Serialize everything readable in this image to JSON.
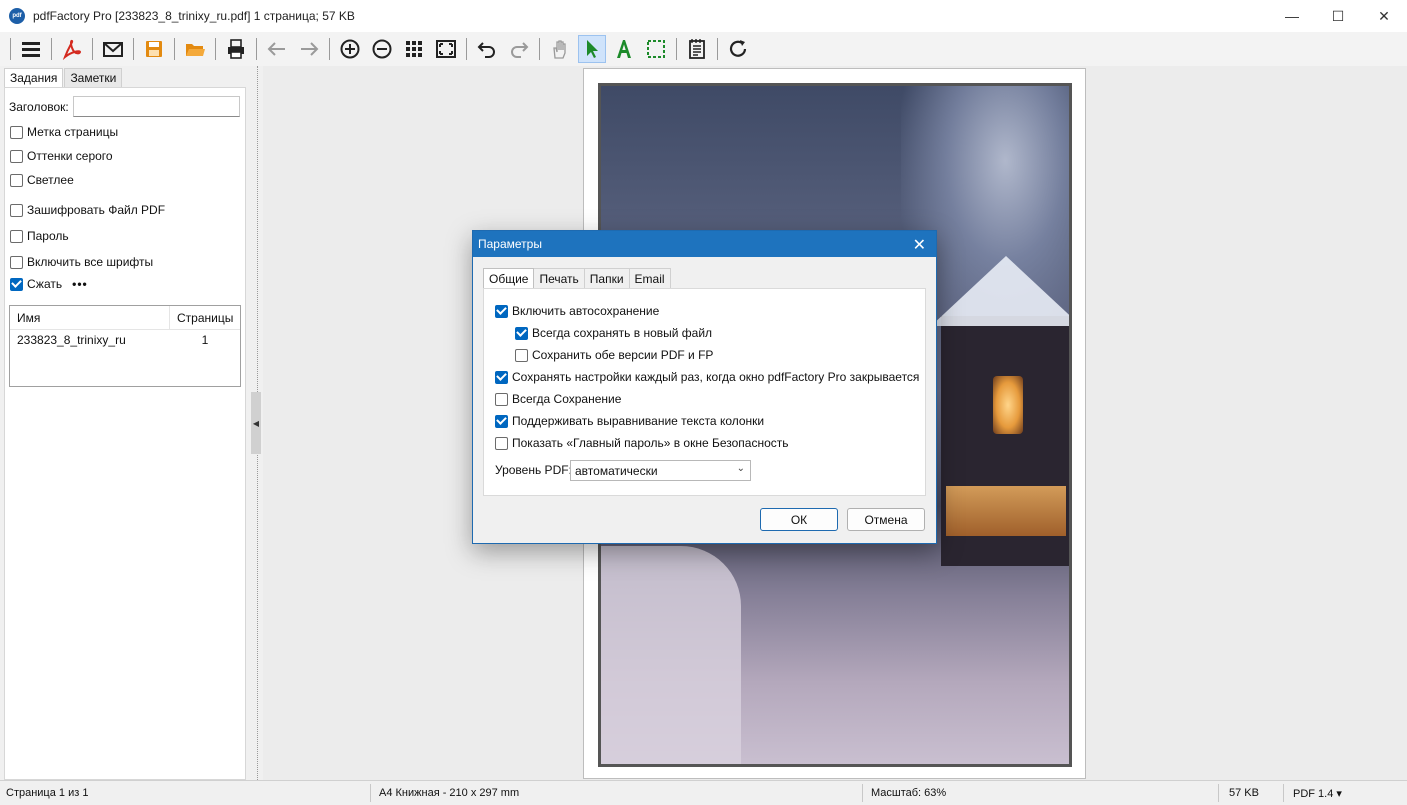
{
  "window": {
    "icon_text": "pdf",
    "title": "pdfFactory Pro [233823_8_trinixy_ru.pdf] 1 страница; 57 KB"
  },
  "toolbar": {
    "icons": [
      "menu-icon",
      "pdf-icon",
      "mail-icon",
      "save-icon",
      "open-folder-icon",
      "print-icon",
      "back-arrow-icon",
      "forward-arrow-icon",
      "zoom-in-icon",
      "zoom-out-icon",
      "grid-icon",
      "fit-page-icon",
      "undo-icon",
      "redo-icon",
      "hand-icon",
      "pointer-icon",
      "text-tool-icon",
      "select-rect-icon",
      "notes-icon",
      "refresh-icon"
    ],
    "colors": {
      "pdf": "#d42a1f",
      "save": "#e38a10",
      "folder": "#e38a10",
      "pointer": "#1c8a2a",
      "text_tool": "#1c8a2a",
      "select": "#1c8a2a"
    }
  },
  "left_panel": {
    "tabs": [
      "Задания",
      "Заметки"
    ],
    "title_label": "Заголовок:",
    "title_value": "",
    "options": [
      {
        "label": "Метка страницы",
        "checked": false
      },
      {
        "label": "Оттенки серого",
        "checked": false
      },
      {
        "label": "Светлее",
        "checked": false
      },
      {
        "label": "Зашифровать Файл PDF",
        "checked": false
      },
      {
        "label": "Пароль",
        "checked": false
      },
      {
        "label": "Включить все шрифты",
        "checked": false
      },
      {
        "label": "Сжать",
        "checked": true
      }
    ],
    "compress_more": "•••",
    "jobs": {
      "headers": [
        "Имя",
        "Страницы"
      ],
      "rows": [
        {
          "name": "233823_8_trinixy_ru",
          "pages": "1"
        }
      ]
    }
  },
  "dialog": {
    "title": "Параметры",
    "tabs": [
      "Общие",
      "Печать",
      "Папки",
      "Email"
    ],
    "active_tab": "Общие",
    "options": [
      {
        "label": "Включить автосохранение",
        "checked": true,
        "indent": 0
      },
      {
        "label": "Всегда сохранять в новый файл",
        "checked": true,
        "indent": 1
      },
      {
        "label": "Сохранить обе версии PDF и FP",
        "checked": false,
        "indent": 1
      },
      {
        "label": "Сохранять настройки каждый раз, когда окно pdfFactory Pro закрывается",
        "checked": true,
        "indent": 0
      },
      {
        "label": "Всегда Сохранение",
        "checked": false,
        "indent": 0
      },
      {
        "label": "Поддерживать выравнивание текста колонки",
        "checked": true,
        "indent": 0
      },
      {
        "label": "Показать «Главный пароль» в окне Безопасность",
        "checked": false,
        "indent": 0
      }
    ],
    "pdf_level_label": "Уровень PDF:",
    "pdf_level_value": "автоматически",
    "ok_label": "ОК",
    "cancel_label": "Отмена"
  },
  "statusbar": {
    "page": "Страница 1 из 1",
    "paper": "A4 Книжная - 210 x 297 mm",
    "zoom": "Масштаб: 63%",
    "size": "57 KB",
    "pdf_version": "PDF 1.4 ▾"
  }
}
